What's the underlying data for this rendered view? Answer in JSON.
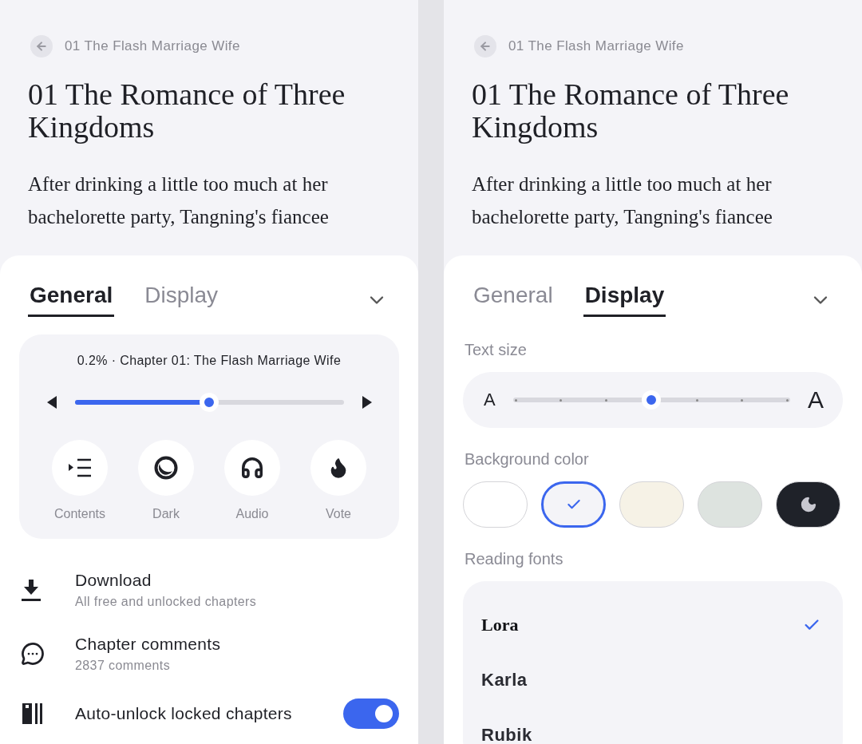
{
  "screens": [
    {
      "reader": {
        "back_label": "01 The Flash Marriage Wife",
        "title": "01 The Romance of Three Kingdoms",
        "body": "After drinking a little too much at her bachelorette party, Tangning's fiancee"
      },
      "sheet": {
        "tabs": [
          {
            "label": "General",
            "selected": true
          },
          {
            "label": "Display",
            "selected": false
          }
        ],
        "panel": {
          "kind": "general",
          "progress_text": "0.2% · Chapter 01: The Flash Marriage Wife",
          "progress": {
            "level": 0.5
          },
          "actions": [
            {
              "kind": "contents",
              "label": "Contents"
            },
            {
              "kind": "dark",
              "label": "Dark"
            },
            {
              "kind": "audio",
              "label": "Audio"
            },
            {
              "kind": "vote",
              "label": "Vote"
            }
          ],
          "options": [
            {
              "kind": "download",
              "title": "Download",
              "subtitle": "All free and unlocked chapters"
            },
            {
              "kind": "comments",
              "title": "Chapter comments",
              "subtitle": "2837 comments"
            },
            {
              "kind": "autounlock",
              "title": "Auto-unlock locked chapters",
              "on": true
            }
          ]
        }
      }
    },
    {
      "reader": {
        "back_label": "01 The Flash Marriage Wife",
        "title": "01 The Romance of Three Kingdoms",
        "body": "After drinking a little too much at her bachelorette party, Tangning's fiancee"
      },
      "sheet": {
        "tabs": [
          {
            "label": "General",
            "selected": false
          },
          {
            "label": "Display",
            "selected": true
          }
        ],
        "panel": {
          "kind": "display",
          "text_size_label": "Text size",
          "small_a": "A",
          "large_a": "A",
          "text_size": {
            "level": 0.5
          },
          "background_label": "Background color",
          "backgrounds": [
            {
              "color": "#ffffff",
              "selected": false
            },
            {
              "color": "#f4f4f8",
              "selected": true
            },
            {
              "color": "#f6f2e6",
              "selected": false
            },
            {
              "color": "#dde3df",
              "selected": false
            },
            {
              "color": "#1f2229",
              "selected": false,
              "kind": "dark"
            }
          ],
          "fonts_label": "Reading fonts",
          "fonts": [
            {
              "name": "Lora",
              "kind": "serif",
              "selected": true
            },
            {
              "name": "Karla",
              "kind": "sans",
              "selected": false
            },
            {
              "name": "Rubik",
              "kind": "sans",
              "selected": false
            }
          ]
        }
      }
    }
  ]
}
